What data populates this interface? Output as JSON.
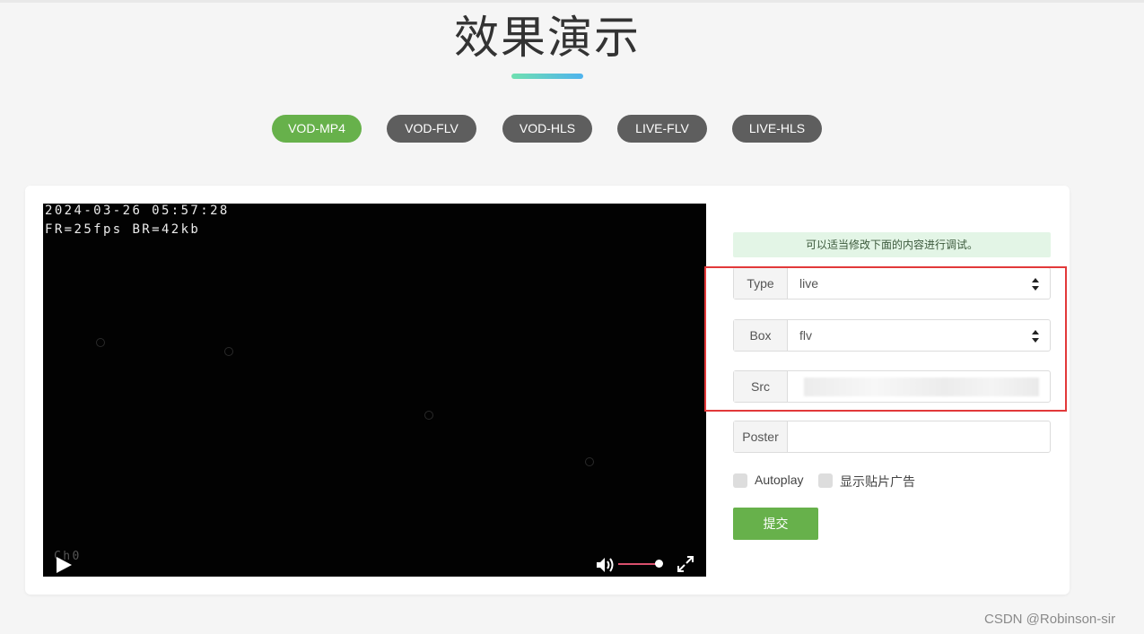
{
  "header": {
    "title": "效果演示"
  },
  "tabs": [
    {
      "label": "VOD-MP4",
      "active": true
    },
    {
      "label": "VOD-FLV",
      "active": false
    },
    {
      "label": "VOD-HLS",
      "active": false
    },
    {
      "label": "LIVE-FLV",
      "active": false
    },
    {
      "label": "LIVE-HLS",
      "active": false
    }
  ],
  "player": {
    "timestamp": "2024-03-26 05:57:28",
    "stats": "FR=25fps BR=42kb",
    "channel": "Ch0",
    "icons": {
      "play": "play-icon",
      "volume": "volume-icon",
      "fullscreen": "fullscreen-icon"
    },
    "volume_level": 1.0
  },
  "form": {
    "tip": "可以适当修改下面的内容进行调试。",
    "type": {
      "label": "Type",
      "value": "live"
    },
    "box": {
      "label": "Box",
      "value": "flv"
    },
    "src": {
      "label": "Src",
      "value": ""
    },
    "poster": {
      "label": "Poster",
      "value": ""
    },
    "autoplay": {
      "label": "Autoplay",
      "checked": false
    },
    "ads": {
      "label": "显示贴片广告",
      "checked": false
    },
    "submit_label": "提交"
  },
  "colors": {
    "accent": "#67b14b",
    "tab_inactive": "#5e5e5e",
    "highlight": "#e2393a"
  },
  "watermark": "CSDN @Robinson-sir"
}
